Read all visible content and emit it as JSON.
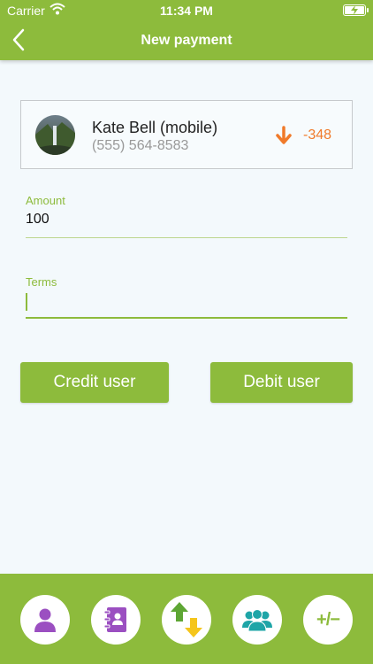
{
  "status_bar": {
    "carrier": "Carrier",
    "time": "11:34 PM"
  },
  "header": {
    "title": "New payment"
  },
  "contact": {
    "name": "Kate  Bell (mobile)",
    "phone": "(555) 564-8583",
    "balance": "-348"
  },
  "form": {
    "amount_label": "Amount",
    "amount_value": "100",
    "terms_label": "Terms",
    "terms_value": ""
  },
  "actions": {
    "credit_label": "Credit user",
    "debit_label": "Debit user"
  },
  "tabbar": {
    "items": [
      {
        "icon": "person-icon"
      },
      {
        "icon": "address-book-icon"
      },
      {
        "icon": "transfer-arrows-icon"
      },
      {
        "icon": "group-icon"
      },
      {
        "icon": "plus-minus-icon",
        "label": "+/−"
      }
    ]
  },
  "colors": {
    "brand_green": "#8dbb3c",
    "balance_orange": "#f07a2a",
    "person_purple": "#9b4fc1",
    "group_teal": "#1ea5a7"
  }
}
